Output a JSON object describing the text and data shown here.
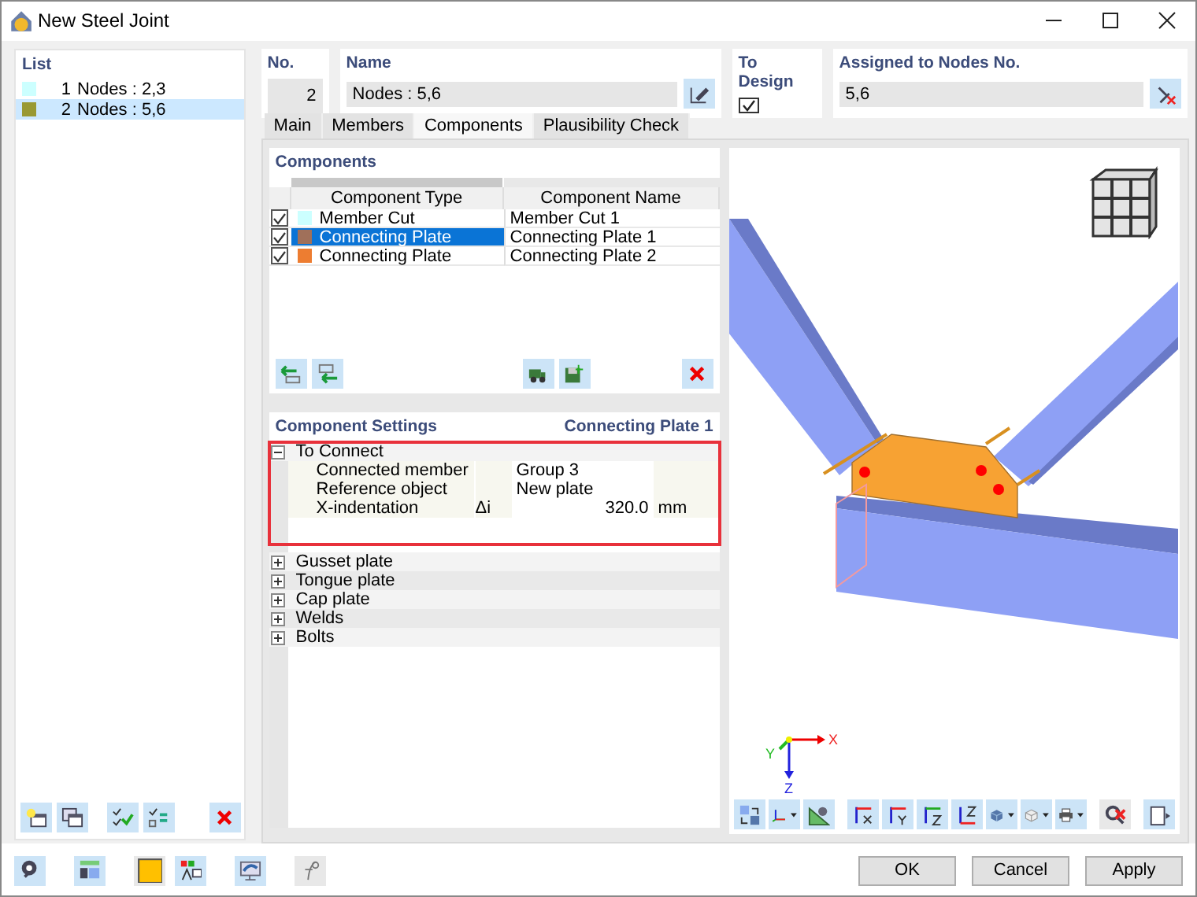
{
  "window": {
    "title": "New Steel Joint"
  },
  "list": {
    "title": "List",
    "items": [
      {
        "number": "1",
        "label": "Nodes : 2,3",
        "color": "#ccffff",
        "selected": false
      },
      {
        "number": "2",
        "label": "Nodes : 5,6",
        "color": "#999933",
        "selected": true
      }
    ]
  },
  "number": {
    "label": "No.",
    "value": "2"
  },
  "name": {
    "label": "Name",
    "value": "Nodes : 5,6"
  },
  "to_design": {
    "label": "To Design",
    "checked": true
  },
  "assigned": {
    "label": "Assigned to Nodes No.",
    "value": "5,6"
  },
  "tabs": [
    {
      "label": "Main",
      "selected": false
    },
    {
      "label": "Members",
      "selected": false
    },
    {
      "label": "Components",
      "selected": true
    },
    {
      "label": "Plausibility Check",
      "selected": false
    }
  ],
  "components": {
    "title": "Components",
    "columns": [
      "Component Type",
      "Component Name"
    ],
    "rows": [
      {
        "checked": true,
        "color": "#ccffff",
        "type": "Member Cut",
        "name": "Member Cut 1",
        "selected": false
      },
      {
        "checked": true,
        "color": "#a0705a",
        "type": "Connecting Plate",
        "name": "Connecting Plate 1",
        "selected": true
      },
      {
        "checked": true,
        "color": "#ed7d31",
        "type": "Connecting Plate",
        "name": "Connecting Plate 2",
        "selected": false
      }
    ]
  },
  "settings": {
    "title": "Component Settings",
    "current": "Connecting Plate 1",
    "groups": [
      {
        "label": "To Connect",
        "expanded": true,
        "highlighted": true,
        "rows": [
          {
            "label": "Connected member",
            "value": "Group 3"
          },
          {
            "label": "Reference object",
            "value": "New plate"
          },
          {
            "label": "X-indentation",
            "symbol": "Δi",
            "value": "320.0",
            "unit": "mm"
          }
        ]
      },
      {
        "label": "Gusset plate",
        "expanded": false,
        "highlighted": false
      },
      {
        "label": "Tongue plate",
        "expanded": false,
        "highlighted": false
      },
      {
        "label": "Cap plate",
        "expanded": false,
        "highlighted": false
      },
      {
        "label": "Welds",
        "expanded": false,
        "highlighted": false
      },
      {
        "label": "Bolts",
        "expanded": false,
        "highlighted": false
      }
    ]
  },
  "view": {
    "axis_labels": [
      "X",
      "Y",
      "Z"
    ]
  },
  "buttons": [
    "OK",
    "Cancel",
    "Apply"
  ]
}
